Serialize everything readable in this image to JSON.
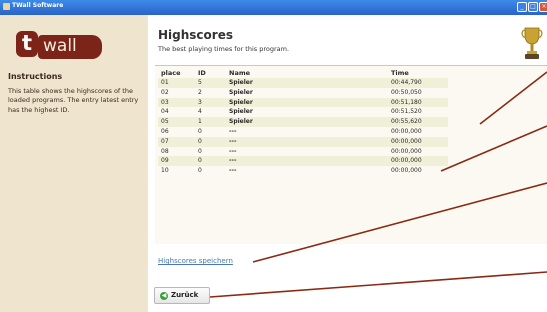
{
  "window": {
    "title": "TWall Software",
    "buttons": [
      "_",
      "□",
      "×"
    ]
  },
  "sidebar": {
    "logo_t": "t",
    "logo_text": "wall",
    "heading": "Instructions",
    "text": "This table shows the highscores of the loaded programs. The entry latest entry has the highest ID."
  },
  "main": {
    "title": "Highscores",
    "subtitle": "The best playing times for this program.",
    "trophy_icon": "trophy-icon"
  },
  "table": {
    "headers": {
      "place": "place",
      "id": "ID",
      "name": "Name",
      "time": "Time"
    },
    "rows": [
      {
        "place": "01",
        "id": "5",
        "name": "Spieler",
        "time": "00:44,790"
      },
      {
        "place": "02",
        "id": "2",
        "name": "Spieler",
        "time": "00:50,050"
      },
      {
        "place": "03",
        "id": "3",
        "name": "Spieler",
        "time": "00:51,180"
      },
      {
        "place": "04",
        "id": "4",
        "name": "Spieler",
        "time": "00:51,520"
      },
      {
        "place": "05",
        "id": "1",
        "name": "Spieler",
        "time": "00:55,620"
      },
      {
        "place": "06",
        "id": "0",
        "name": "---",
        "time": "00:00,000"
      },
      {
        "place": "07",
        "id": "0",
        "name": "---",
        "time": "00:00,000"
      },
      {
        "place": "08",
        "id": "0",
        "name": "---",
        "time": "00:00,000"
      },
      {
        "place": "09",
        "id": "0",
        "name": "---",
        "time": "00:00,000"
      },
      {
        "place": "10",
        "id": "0",
        "name": "---",
        "time": "00:00,000"
      }
    ]
  },
  "actions": {
    "save_link": "Highscores speichern",
    "back_button": "Zurück"
  },
  "colors": {
    "titlebar": "#2a63c9",
    "sidebar": "#efe4cd",
    "logo": "#7b2417",
    "row_alt": "#f0efd7",
    "callout": "#8a2a12"
  }
}
